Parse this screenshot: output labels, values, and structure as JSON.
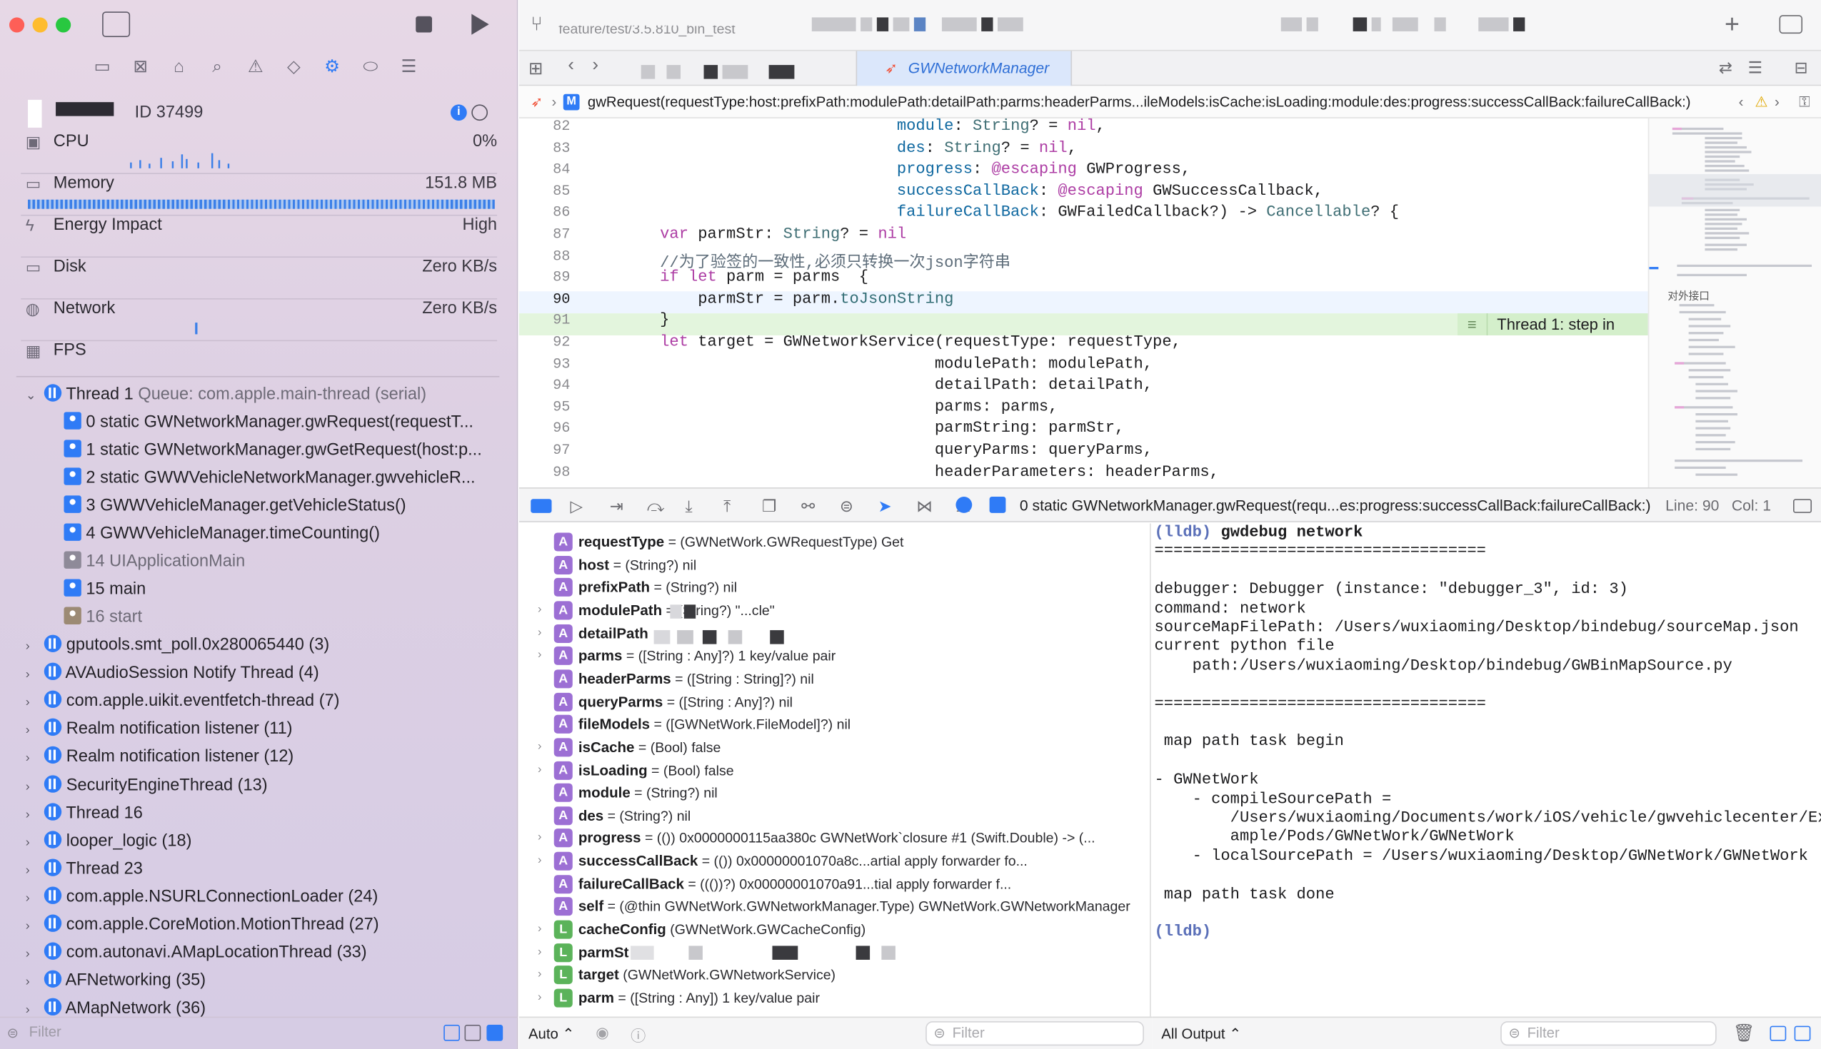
{
  "sidebar": {
    "process_id": "ID 37499",
    "gauges": [
      {
        "name": "CPU",
        "value": "0%"
      },
      {
        "name": "Memory",
        "value": "151.8 MB"
      },
      {
        "name": "Energy Impact",
        "value": "High"
      },
      {
        "name": "Disk",
        "value": "Zero KB/s"
      },
      {
        "name": "Network",
        "value": "Zero KB/s"
      },
      {
        "name": "FPS",
        "value": ""
      }
    ],
    "thread1": {
      "label": "Thread 1",
      "queue": "Queue: com.apple.main-thread (serial)"
    },
    "frames": [
      {
        "text": "0 static GWNetworkManager.gwRequest(requestT...",
        "kind": "user"
      },
      {
        "text": "1 static GWNetworkManager.gwGetRequest(host:p...",
        "kind": "user"
      },
      {
        "text": "2 static GWWVehicleNetworkManager.gwvehicleR...",
        "kind": "user"
      },
      {
        "text": "3 GWWVehicleManager.getVehicleStatus()",
        "kind": "user"
      },
      {
        "text": "4 GWWVehicleManager.timeCounting()",
        "kind": "user"
      },
      {
        "text": "14 UIApplicationMain",
        "kind": "system"
      },
      {
        "text": "15 main",
        "kind": "user"
      },
      {
        "text": "16 start",
        "kind": "start"
      }
    ],
    "threads": [
      "gputools.smt_poll.0x280065440 (3)",
      "AVAudioSession Notify Thread (4)",
      "com.apple.uikit.eventfetch-thread (7)",
      "Realm notification listener (11)",
      "Realm notification listener (12)",
      "SecurityEngineThread (13)",
      "Thread 16",
      "looper_logic (18)",
      "Thread 23",
      "com.apple.NSURLConnectionLoader (24)",
      "com.apple.CoreMotion.MotionThread (27)",
      "com.autonavi.AMapLocationThread (33)",
      "AFNetworking (35)",
      "AMapNetwork (36)"
    ],
    "filter_placeholder": "Filter"
  },
  "toolbar": {
    "branch": "feature/test/3.5.810_bin_test",
    "active_tab": "GWNetworkManager"
  },
  "jumpbar": {
    "badge": "M",
    "method": "gwRequest(requestType:host:prefixPath:modulePath:detailPath:parms:headerParms...ileModels:isCache:isLoading:module:des:progress:successCallBack:failureCallBack:)"
  },
  "editor": {
    "current_line": 90,
    "annotation": "Thread 1: step in",
    "minimap_label": "对外接口",
    "lines": [
      {
        "n": "82",
        "html": "                                 <span class=\"tp\">module</span>: <span class=\"ty\">String</span>? = <span class=\"kw\">nil</span>,"
      },
      {
        "n": "83",
        "html": "                                 <span class=\"tp\">des</span>: <span class=\"ty\">String</span>? = <span class=\"kw\">nil</span>,"
      },
      {
        "n": "84",
        "html": "                                 <span class=\"tp\">progress</span>: <span class=\"kw\">@escaping</span> GWProgress,"
      },
      {
        "n": "85",
        "html": "                                 <span class=\"tp\">successCallBack</span>: <span class=\"kw\">@escaping</span> GWSuccessCallback,"
      },
      {
        "n": "86",
        "html": "                                 <span class=\"tp\">failureCallBack</span>: GWFailedCallback?) -> <span class=\"ty\">Cancellable</span>? {"
      },
      {
        "n": "87",
        "html": "        <span class=\"kw\">var</span> parmStr: <span class=\"ty\">String</span>? = <span class=\"kw\">nil</span>"
      },
      {
        "n": "88",
        "html": "        <span class=\"cm\">//为了验签的一致性,必须只转换一次json字符串</span>"
      },
      {
        "n": "89",
        "html": "        <span class=\"kw\">if let</span> parm = parms  {"
      },
      {
        "n": "90",
        "html": "            parmStr = parm.<span class=\"fn\">toJsonString</span>"
      },
      {
        "n": "91",
        "html": "        }"
      },
      {
        "n": "92",
        "html": "        <span class=\"kw\">let</span> target = GWNetworkService(requestType: requestType,"
      },
      {
        "n": "93",
        "html": "                                     modulePath: modulePath,"
      },
      {
        "n": "94",
        "html": "                                     detailPath: detailPath,"
      },
      {
        "n": "95",
        "html": "                                     parms: parms,"
      },
      {
        "n": "96",
        "html": "                                     parmString: parmStr,"
      },
      {
        "n": "97",
        "html": "                                     queryParms: queryParms,"
      },
      {
        "n": "98",
        "html": "                                     headerParameters: headerParms,"
      }
    ]
  },
  "debugbar": {
    "frame": "0 static GWNetworkManager.gwRequest(requ...es:progress:successCallBack:failureCallBack:)",
    "line": "Line: 90",
    "col": "Col: 1"
  },
  "variables": [
    {
      "kind": "A",
      "name": "requestType",
      "value": " = (GWNetWork.GWRequestType) Get",
      "expand": false
    },
    {
      "kind": "A",
      "name": "host",
      "value": " = (String?) nil",
      "expand": false
    },
    {
      "kind": "A",
      "name": "prefixPath",
      "value": " = (String?) nil",
      "expand": false
    },
    {
      "kind": "A",
      "name": "modulePath",
      "value": " = (String?) \"...cle\"",
      "expand": true
    },
    {
      "kind": "A",
      "name": "detailPath",
      "value": "",
      "expand": true
    },
    {
      "kind": "A",
      "name": "parms",
      "value": " = ([String : Any]?) 1 key/value pair",
      "expand": true
    },
    {
      "kind": "A",
      "name": "headerParms",
      "value": " = ([String : String]?) nil",
      "expand": false
    },
    {
      "kind": "A",
      "name": "queryParms",
      "value": " = ([String : Any]?) nil",
      "expand": false
    },
    {
      "kind": "A",
      "name": "fileModels",
      "value": " = ([GWNetWork.FileModel]?) nil",
      "expand": false
    },
    {
      "kind": "A",
      "name": "isCache",
      "value": " = (Bool) false",
      "expand": true
    },
    {
      "kind": "A",
      "name": "isLoading",
      "value": " = (Bool) false",
      "expand": true
    },
    {
      "kind": "A",
      "name": "module",
      "value": " = (String?) nil",
      "expand": false
    },
    {
      "kind": "A",
      "name": "des",
      "value": " = (String?) nil",
      "expand": false
    },
    {
      "kind": "A",
      "name": "progress",
      "value": " = (()) 0x0000000115aa380c GWNetWork`closure #1 (Swift.Double) -> (...",
      "expand": true
    },
    {
      "kind": "A",
      "name": "successCallBack",
      "value": " = (()) 0x00000001070a8c...artial apply forwarder fo...",
      "expand": true
    },
    {
      "kind": "A",
      "name": "failureCallBack",
      "value": " = ((())?) 0x00000001070a91...tial apply forwarder f...",
      "expand": false
    },
    {
      "kind": "A",
      "name": "self",
      "value": " = (@thin GWNetWork.GWNetworkManager.Type) GWNetWork.GWNetworkManager",
      "expand": false
    },
    {
      "kind": "L",
      "name": "cacheConfig",
      "value": " (GWNetWork.GWCacheConfig)",
      "expand": true
    },
    {
      "kind": "L",
      "name": "parmSt",
      "value": "",
      "expand": true
    },
    {
      "kind": "L",
      "name": "target",
      "value": " (GWNetWork.GWNetworkService)",
      "expand": true
    },
    {
      "kind": "L",
      "name": "parm",
      "value": " = ([String : Any]) 1 key/value pair",
      "expand": true
    }
  ],
  "console": {
    "lines": [
      {
        "cls": "",
        "html": "<span class=\"lldb\">(lldb)</span> <b>gwdebug network</b>"
      },
      {
        "cls": "",
        "html": "==================================="
      },
      {
        "cls": "",
        "html": ""
      },
      {
        "cls": "",
        "html": "debugger: Debugger (instance: \"debugger_3\", id: 3)"
      },
      {
        "cls": "",
        "html": "command: network"
      },
      {
        "cls": "",
        "html": "sourceMapFilePath: /Users/wuxiaoming/Desktop/bindebug/sourceMap.json"
      },
      {
        "cls": "",
        "html": "current python file"
      },
      {
        "cls": "",
        "html": "    path:/Users/wuxiaoming/Desktop/bindebug/GWBinMapSource.py"
      },
      {
        "cls": "",
        "html": ""
      },
      {
        "cls": "",
        "html": "==================================="
      },
      {
        "cls": "",
        "html": ""
      },
      {
        "cls": "",
        "html": " map path task begin"
      },
      {
        "cls": "",
        "html": ""
      },
      {
        "cls": "",
        "html": "- GWNetWork"
      },
      {
        "cls": "",
        "html": "    - compileSourcePath ="
      },
      {
        "cls": "",
        "html": "        /Users/wuxiaoming/Documents/work/iOS/vehicle/gwvehiclecenter/Ex"
      },
      {
        "cls": "",
        "html": "        ample/Pods/GWNetWork/GWNetWork"
      },
      {
        "cls": "",
        "html": "    - localSourcePath = /Users/wuxiaoming/Desktop/GWNetWork/GWNetWork"
      },
      {
        "cls": "",
        "html": ""
      },
      {
        "cls": "",
        "html": " map path task done"
      },
      {
        "cls": "",
        "html": ""
      },
      {
        "cls": "",
        "html": "<span class=\"lldb\">(lldb)</span>"
      }
    ]
  },
  "footer": {
    "auto_label": "Auto ⌃",
    "vars_filter": "Filter",
    "output_label": "All Output ⌃",
    "console_filter": "Filter"
  },
  "colors": {
    "accent": "#2f7bf6",
    "highlight_line": "#e8f2ff",
    "annotation_bg": "#e2f4dc"
  }
}
